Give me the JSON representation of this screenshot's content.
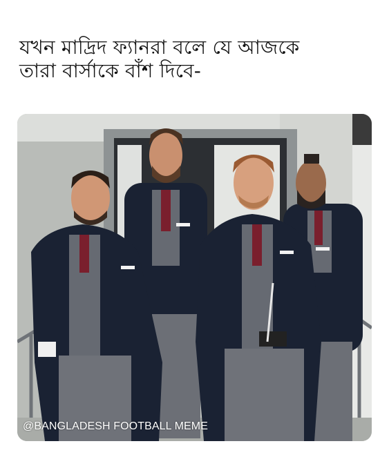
{
  "caption": {
    "line1": "যখন মাদ্রিদ ফ্যানরা বলে যে আজকে",
    "line2": "তারা বার্সাকে বাঁশ দিবে-"
  },
  "photo": {
    "watermark": "@BANGLADESH FOOTBALL MEME"
  },
  "colors": {
    "background": "#ffffff",
    "caption_text": "#111111",
    "jacket": "#1a2233",
    "vest_trousers": "#6c6f76",
    "wall": "#c8cbc7"
  }
}
